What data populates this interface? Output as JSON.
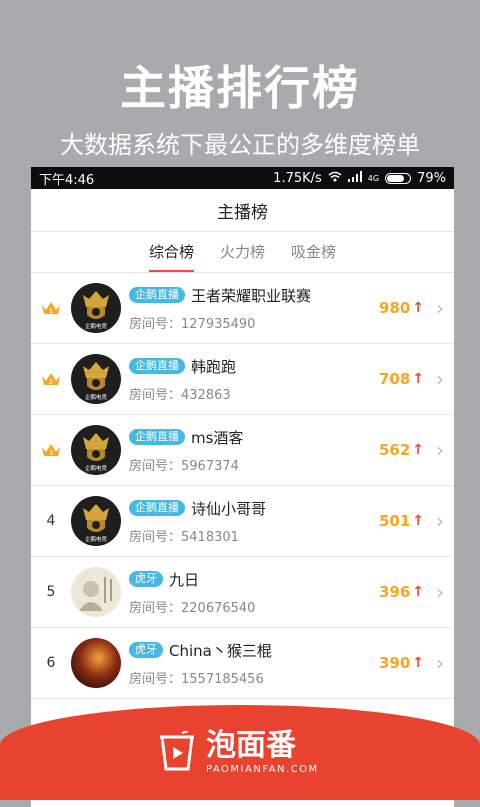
{
  "promo": {
    "title": "主播排行榜",
    "subtitle": "大数据系统下最公正的多维度榜单"
  },
  "statusbar": {
    "time": "下午4:46",
    "speed": "1.75K/s",
    "network": "4G",
    "battery": "79%"
  },
  "header": {
    "title": "主播榜"
  },
  "tabs": [
    {
      "label": "综合榜",
      "active": true
    },
    {
      "label": "火力榜",
      "active": false
    },
    {
      "label": "吸金榜",
      "active": false
    }
  ],
  "room_label": "房间号：",
  "rows": [
    {
      "rank": "1",
      "crown": true,
      "avatar_text": "企鹅电竞",
      "platform": "企鹅直播",
      "name": "王者荣耀职业联赛",
      "room": "127935490",
      "score": "980"
    },
    {
      "rank": "2",
      "crown": true,
      "avatar_text": "企鹅电竞",
      "platform": "企鹅直播",
      "name": "韩跑跑",
      "room": "432863",
      "score": "708"
    },
    {
      "rank": "3",
      "crown": true,
      "avatar_text": "企鹅电竞",
      "platform": "企鹅直播",
      "name": "ms酒客",
      "room": "5967374",
      "score": "562"
    },
    {
      "rank": "4",
      "crown": false,
      "avatar_text": "企鹅电竞",
      "platform": "企鹅直播",
      "name": "诗仙小哥哥",
      "room": "5418301",
      "score": "501"
    },
    {
      "rank": "5",
      "crown": false,
      "avatar_text": "",
      "platform": "虎牙",
      "name": "九日",
      "room": "220676540",
      "score": "396"
    },
    {
      "rank": "6",
      "crown": false,
      "avatar_text": "",
      "platform": "虎牙",
      "name": "China丶猴三棍",
      "room": "1557185456",
      "score": "390"
    }
  ],
  "brand": {
    "name": "泡面番",
    "url": "PAOMIANFAN.COM"
  },
  "colors": {
    "accent": "#e94b3c",
    "score": "#f5a623",
    "badge": "#47b8e0",
    "brand": "#e8432f"
  }
}
